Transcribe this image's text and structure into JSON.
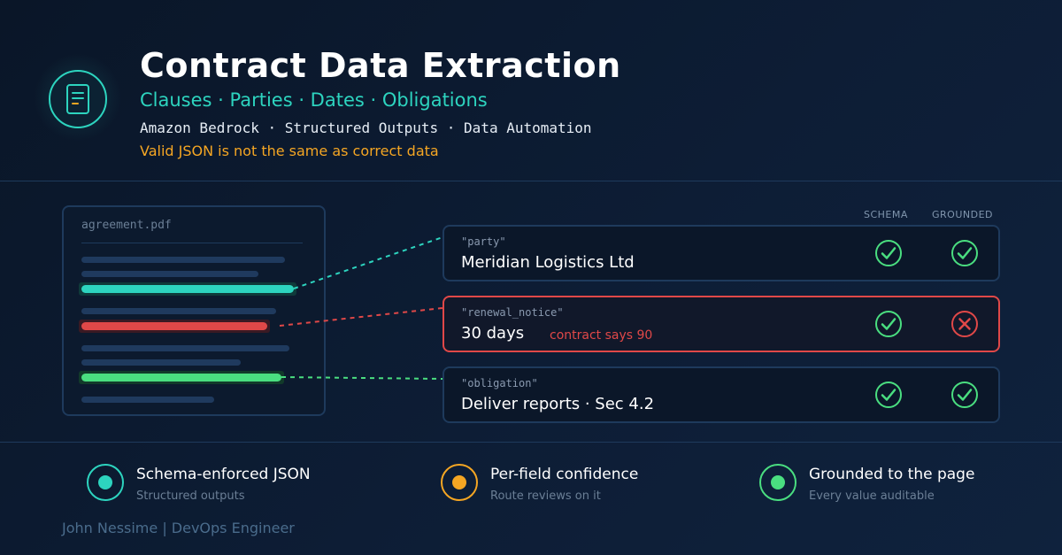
{
  "header": {
    "icon": "document-icon",
    "title": "Contract Data Extraction",
    "subtitle": "Clauses · Parties · Dates · Obligations",
    "tech_line": "Amazon Bedrock · Structured Outputs · Data Automation",
    "warning": "Valid JSON is not the same as correct data"
  },
  "document": {
    "filename": "agreement.pdf"
  },
  "columns": {
    "schema": "SCHEMA",
    "grounded": "GROUNDED"
  },
  "fields": [
    {
      "key": "\"party\"",
      "value": "Meridian Logistics Ltd",
      "note": "",
      "schema_valid": true,
      "grounded": true,
      "highlight_color": "#2dd4bf"
    },
    {
      "key": "\"renewal_notice\"",
      "value": "30 days",
      "note": "contract says 90",
      "schema_valid": true,
      "grounded": false,
      "highlight_color": "#e04848"
    },
    {
      "key": "\"obligation\"",
      "value": "Deliver reports · Sec 4.2",
      "note": "",
      "schema_valid": true,
      "grounded": true,
      "highlight_color": "#4ade80"
    }
  ],
  "features": [
    {
      "title": "Schema-enforced JSON",
      "subtitle": "Structured outputs",
      "color": "#2dd4bf"
    },
    {
      "title": "Per-field confidence",
      "subtitle": "Route reviews on it",
      "color": "#f5a623"
    },
    {
      "title": "Grounded to the page",
      "subtitle": "Every value auditable",
      "color": "#4ade80"
    }
  ],
  "byline": "John Nessime | DevOps Engineer",
  "colors": {
    "accent": "#2dd4bf",
    "warning": "#f5a623",
    "error": "#e04848",
    "success": "#4ade80"
  }
}
